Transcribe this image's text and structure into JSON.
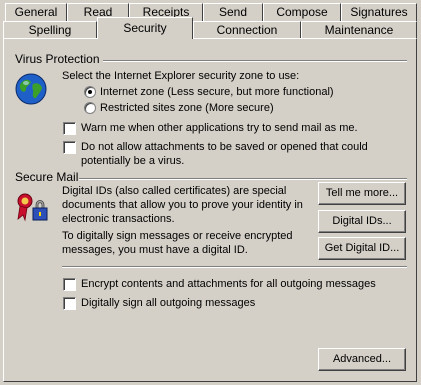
{
  "tabs_row1": [
    "General",
    "Read",
    "Receipts",
    "Send",
    "Compose",
    "Signatures"
  ],
  "tabs_row2": [
    "Spelling",
    "Security",
    "Connection",
    "Maintenance"
  ],
  "active_tab": "Security",
  "virus": {
    "title": "Virus Protection",
    "zone_prompt": "Select the Internet Explorer security zone to use:",
    "zone_internet": "Internet zone (Less secure, but more functional)",
    "zone_restricted": "Restricted sites zone (More secure)",
    "selected_zone": "internet",
    "warn_label": "Warn me when other applications try to send mail as me.",
    "warn_checked": false,
    "block_label": "Do not allow attachments to be saved or opened that could potentially be a virus.",
    "block_checked": false
  },
  "secure": {
    "title": "Secure Mail",
    "desc1": "Digital IDs (also called certificates) are special documents that allow you to prove your identity in electronic transactions.",
    "desc2": "To digitally sign messages or receive encrypted messages, you must have a digital ID.",
    "tell_more": "Tell me more...",
    "digital_ids": "Digital IDs...",
    "get_id": "Get Digital ID...",
    "encrypt_label": "Encrypt contents and attachments for all outgoing messages",
    "encrypt_checked": false,
    "sign_label": "Digitally sign all outgoing messages",
    "sign_checked": false
  },
  "advanced": "Advanced..."
}
